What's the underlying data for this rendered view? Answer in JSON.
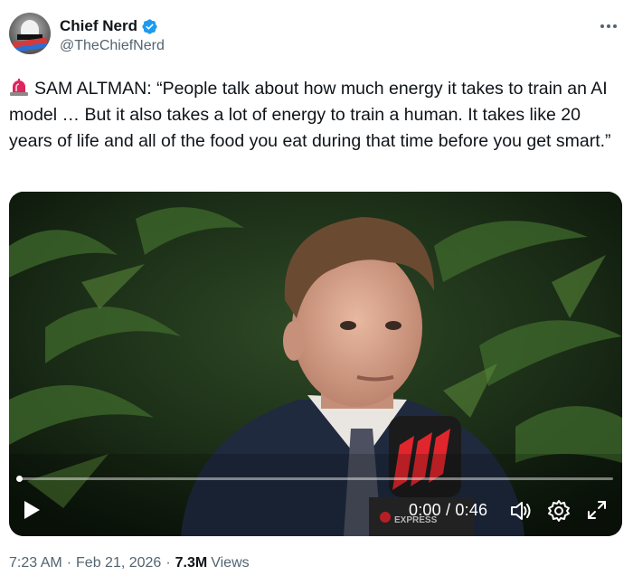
{
  "author": {
    "display_name": "Chief Nerd",
    "handle": "@TheChiefNerd",
    "verified_icon": "verified-badge-icon",
    "verified_color": "#1d9bf0"
  },
  "more_icon": "more-options-icon",
  "tweet": {
    "emoji": "🚨",
    "text": "SAM ALTMAN: “People talk about how much energy it takes to train an AI model … But it also takes a lot of energy to train a human. It takes like 20 years of life and all of the food you eat during that time before you get smart.”"
  },
  "video": {
    "progress_fraction": 0.0,
    "current_time": "0:00",
    "separator": "/",
    "duration": "0:46",
    "time_display": "0:00 / 0:46",
    "watermark": "EXPRESS",
    "icons": {
      "play": "play-icon",
      "volume": "volume-icon",
      "settings": "gear-icon",
      "fullscreen": "fullscreen-icon"
    }
  },
  "meta": {
    "time": "7:23 AM",
    "date": "Feb 21, 2026",
    "views_count": "7.3M",
    "views_label": "Views",
    "dot": "·"
  },
  "colors": {
    "text_primary": "#0f1419",
    "text_secondary": "#536471",
    "accent": "#1d9bf0"
  }
}
